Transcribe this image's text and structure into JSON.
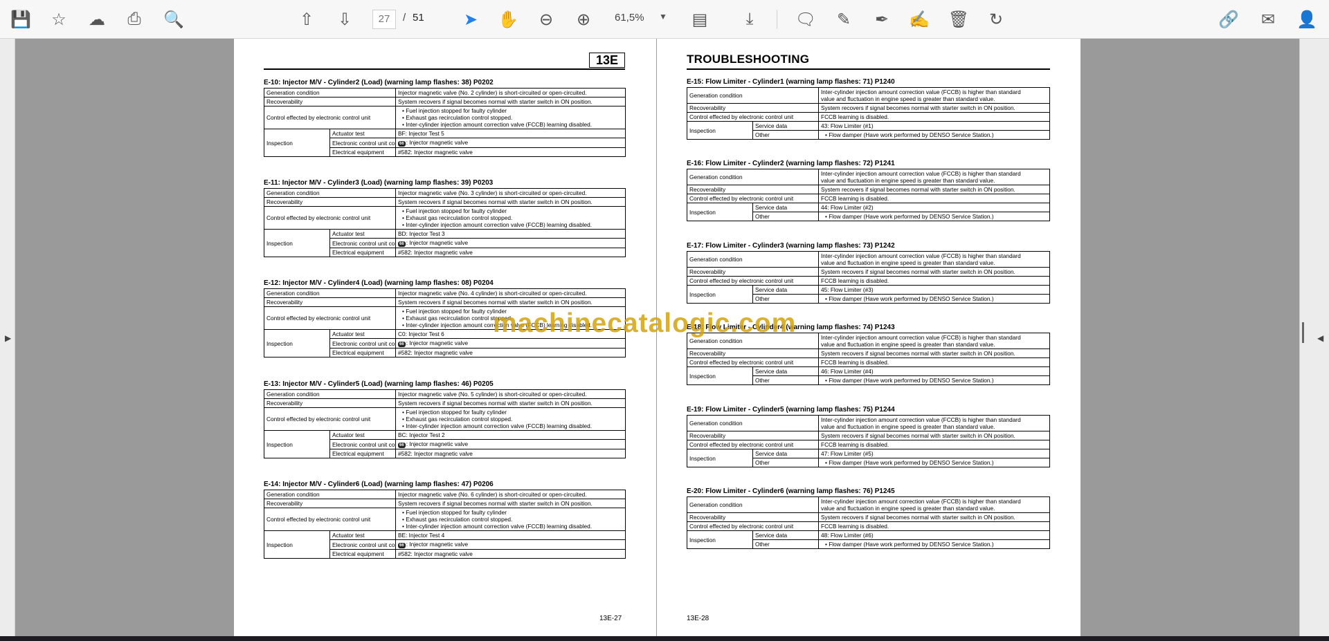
{
  "toolbar": {
    "page_current": "27",
    "page_separator": "/",
    "page_total": "51",
    "zoom": "61,5%"
  },
  "left_page": {
    "badge": "13E",
    "footer": "13E-27",
    "sections": [
      {
        "title": "E-10: Injector M/V - Cylinder2 (Load) (warning lamp flashes: 38) P0202",
        "gen": "Injector magnetic valve (No. 2 cylinder) is short-circuited or open-circuited.",
        "act": "BF: Injector Test 5"
      },
      {
        "title": "E-11: Injector M/V - Cylinder3 (Load) (warning lamp flashes: 39) P0203",
        "gen": "Injector magnetic valve (No. 3 cylinder) is short-circuited or open-circuited.",
        "act": "BD: Injector Test 3"
      },
      {
        "title": "E-12: Injector M/V - Cylinder4 (Load) (warning lamp flashes: 08) P0204",
        "gen": "Injector magnetic valve (No. 4 cylinder) is short-circuited or open-circuited.",
        "act": "C0: Injector Test 6"
      },
      {
        "title": "E-13: Injector M/V - Cylinder5 (Load) (warning lamp flashes: 46) P0205",
        "gen": "Injector magnetic valve (No. 5 cylinder) is short-circuited or open-circuited.",
        "act": "BC: Injector Test 2"
      },
      {
        "title": "E-14: Injector M/V - Cylinder6 (Load) (warning lamp flashes: 47) P0206",
        "gen": "Injector magnetic valve (No. 6 cylinder) is short-circuited or open-circuited.",
        "act": "BE: Injector Test 4"
      }
    ],
    "labels": {
      "gen": "Generation condition",
      "rec": "Recoverability",
      "ctrl": "Control effected by electronic control unit",
      "insp": "Inspection",
      "act": "Actuator test",
      "ecu": "Electronic control unit connector",
      "elec": "Electrical equipment"
    },
    "common": {
      "rec": "System recovers if signal becomes normal with starter switch in ON position.",
      "ctrl1": "Fuel injection stopped for faulty cylinder",
      "ctrl2": "Exhaust gas recirculation control stopped.",
      "ctrl3": "Inter-cylinder injection amount correction valve (FCCB) learning disabled.",
      "ecu_tag": "66",
      "ecu": ": Injector magnetic valve",
      "elec": "#582: Injector magnetic valve"
    }
  },
  "right_page": {
    "title": "TROUBLESHOOTING",
    "footer": "13E-28",
    "sections": [
      {
        "title": "E-15: Flow Limiter - Cylinder1 (warning lamp flashes: 71) P1240",
        "svc": "43: Flow Limiter (#1)"
      },
      {
        "title": "E-16: Flow Limiter - Cylinder2 (warning lamp flashes: 72) P1241",
        "svc": "44: Flow Limiter (#2)"
      },
      {
        "title": "E-17: Flow Limiter - Cylinder3 (warning lamp flashes: 73) P1242",
        "svc": "45: Flow Limiter (#3)"
      },
      {
        "title": "E-18: Flow Limiter - Cylinder4 (warning lamp flashes: 74) P1243",
        "svc": "46: Flow Limiter (#4)"
      },
      {
        "title": "E-19: Flow Limiter - Cylinder5 (warning lamp flashes: 75) P1244",
        "svc": "47: Flow Limiter (#5)"
      },
      {
        "title": "E-20: Flow Limiter - Cylinder6 (warning lamp flashes: 76) P1245",
        "svc": "48: Flow Limiter (#6)"
      }
    ],
    "labels": {
      "gen": "Generation condition",
      "rec": "Recoverability",
      "ctrl": "Control effected by electronic control unit",
      "insp": "Inspection",
      "svc": "Service data",
      "other": "Other"
    },
    "common": {
      "gen1": "Inter-cylinder injection amount correction value (FCCB) is higher than standard",
      "gen2": "value and fluctuation in engine speed is greater than standard value.",
      "rec": "System recovers if signal becomes normal with starter switch in ON position.",
      "ctrl": "FCCB learning is disabled.",
      "other": "Flow damper (Have work performed by DENSO Service Station.)"
    }
  },
  "watermark": "machinecatalogic.com",
  "colors": {
    "toolbar_bg": "#f7f7f7",
    "canvas_bg": "#9a9a9a",
    "accent": "#2680eb",
    "watermark": "#d4a310"
  }
}
